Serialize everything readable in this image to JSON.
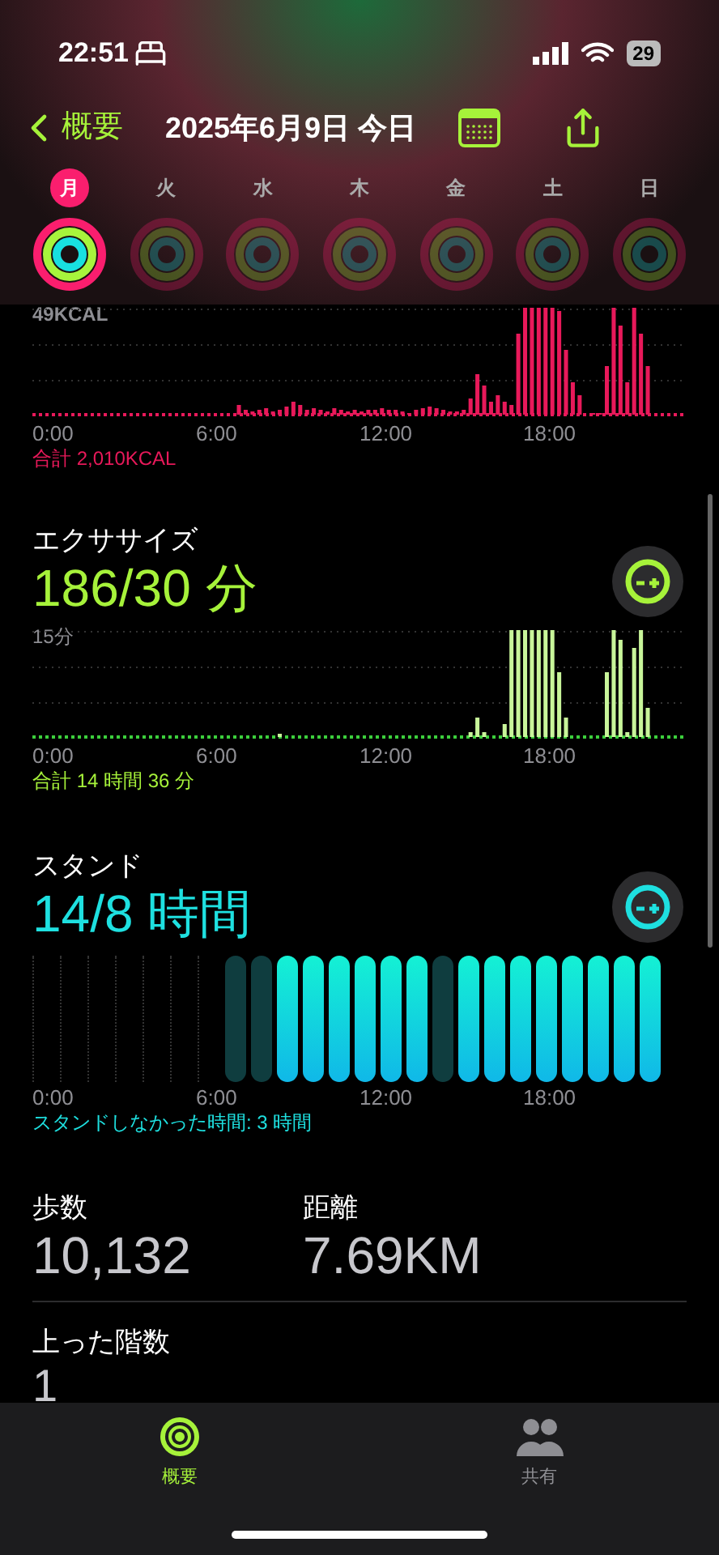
{
  "status_bar": {
    "time": "22:51",
    "battery": "29"
  },
  "nav": {
    "back": "概要",
    "title": "2025年6月9日 今日"
  },
  "week": [
    {
      "label": "月",
      "selected": true
    },
    {
      "label": "火",
      "selected": false
    },
    {
      "label": "水",
      "selected": false
    },
    {
      "label": "木",
      "selected": false
    },
    {
      "label": "金",
      "selected": false
    },
    {
      "label": "土",
      "selected": false
    },
    {
      "label": "日",
      "selected": false
    }
  ],
  "move": {
    "y_label": "49KCAL",
    "x_labels": [
      "0:00",
      "6:00",
      "12:00",
      "18:00"
    ],
    "total": "合計 2,010KCAL"
  },
  "exercise": {
    "title": "エクササイズ",
    "value": "186/30 分",
    "y_label": "15分",
    "x_labels": [
      "0:00",
      "6:00",
      "12:00",
      "18:00"
    ],
    "total": "合計 14 時間 36 分"
  },
  "stand": {
    "title": "スタンド",
    "value": "14/8 時間",
    "hours": [
      {
        "kind": "none"
      },
      {
        "kind": "none"
      },
      {
        "kind": "none"
      },
      {
        "kind": "none"
      },
      {
        "kind": "none"
      },
      {
        "kind": "none"
      },
      {
        "kind": "none"
      },
      {
        "kind": "missed"
      },
      {
        "kind": "missed"
      },
      {
        "kind": "stood"
      },
      {
        "kind": "stood"
      },
      {
        "kind": "stood"
      },
      {
        "kind": "stood"
      },
      {
        "kind": "stood"
      },
      {
        "kind": "stood"
      },
      {
        "kind": "missed"
      },
      {
        "kind": "stood"
      },
      {
        "kind": "stood"
      },
      {
        "kind": "stood"
      },
      {
        "kind": "stood"
      },
      {
        "kind": "stood"
      },
      {
        "kind": "stood"
      },
      {
        "kind": "stood"
      },
      {
        "kind": "stood"
      }
    ],
    "x_labels": [
      "0:00",
      "6:00",
      "12:00",
      "18:00"
    ],
    "note": "スタンドしなかった時間: 3 時間"
  },
  "stats": [
    {
      "label": "歩数",
      "value": "10,132"
    },
    {
      "label": "距離",
      "value": "7.69KM"
    }
  ],
  "floors": {
    "label": "上った階数",
    "value": "1"
  },
  "tab_bar": [
    {
      "label": "概要",
      "selected": true
    },
    {
      "label": "共有",
      "selected": false
    }
  ]
}
